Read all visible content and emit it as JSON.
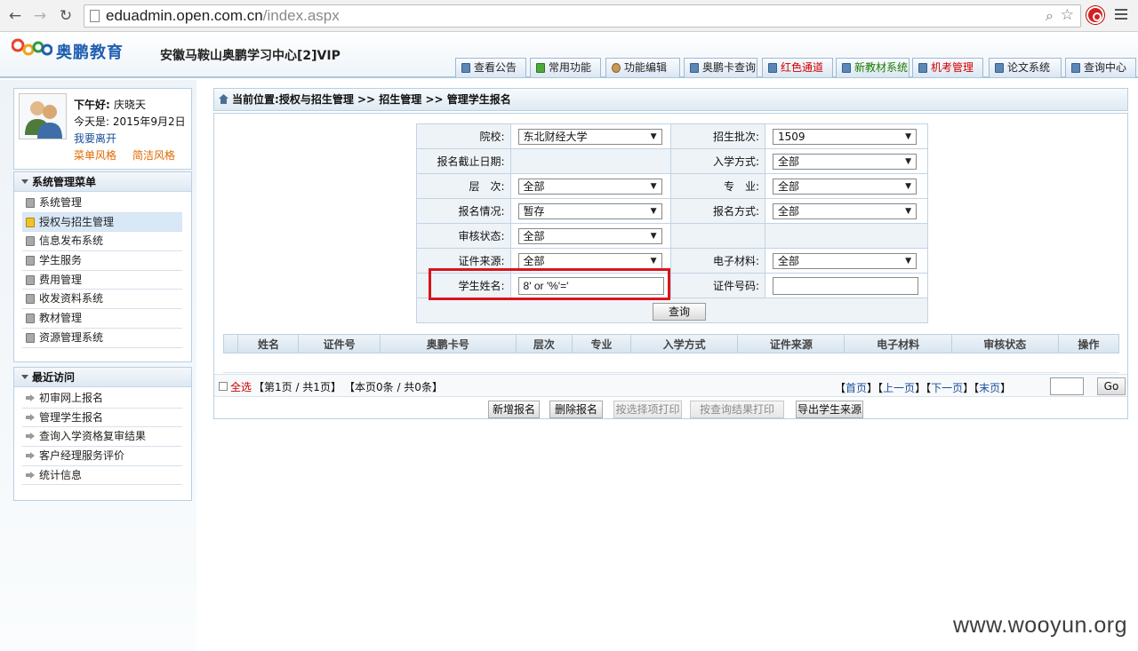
{
  "browser": {
    "url_host": "eduadmin.open.com.cn",
    "url_path": "/index.aspx"
  },
  "header": {
    "logo_text": "奥鹏教育",
    "center_name": "安徽马鞍山奥鹏学习中心[2]VIP",
    "nav": [
      "查看公告",
      "常用功能",
      "功能编辑",
      "奥鹏卡查询",
      "红色通道",
      "新教材系统",
      "机考管理",
      "论文系统",
      "查询中心"
    ]
  },
  "user": {
    "greeting": "下午好:",
    "name": "庆晓天",
    "today": "今天是: 2015年9月2日",
    "leave": "我要离开",
    "style_menu": "菜单风格",
    "style_simple": "简洁风格"
  },
  "system_menu": {
    "title": "系统管理菜单",
    "items": [
      "系统管理",
      "授权与招生管理",
      "信息发布系统",
      "学生服务",
      "费用管理",
      "收发资料系统",
      "教材管理",
      "资源管理系统"
    ]
  },
  "recent": {
    "title": "最近访问",
    "items": [
      "初审网上报名",
      "管理学生报名",
      "查询入学资格复审结果",
      "客户经理服务评价",
      "统计信息"
    ]
  },
  "breadcrumb": {
    "label": "当前位置:",
    "path": "授权与招生管理 >> 招生管理 >> 管理学生报名"
  },
  "form": {
    "school_label": "院校:",
    "school_value": "东北财经大学",
    "batch_label": "招生批次:",
    "batch_value": "1509",
    "deadline_label": "报名截止日期:",
    "entry_label": "入学方式:",
    "entry_value": "全部",
    "level_label": "层　次:",
    "level_value": "全部",
    "major_label": "专　业:",
    "major_value": "全部",
    "signup_label": "报名情况:",
    "signup_value": "暂存",
    "method_label": "报名方式:",
    "method_value": "全部",
    "audit_label": "审核状态:",
    "audit_value": "全部",
    "idsource_label": "证件来源:",
    "idsource_value": "全部",
    "emat_label": "电子材料:",
    "emat_value": "全部",
    "name_label": "学生姓名:",
    "name_value": "8' or '%'='",
    "idno_label": "证件号码:",
    "idno_value": "",
    "query_button": "查询"
  },
  "table": {
    "columns": [
      "姓名",
      "证件号",
      "奥鹏卡号",
      "层次",
      "专业",
      "入学方式",
      "证件来源",
      "电子材料",
      "审核状态",
      "操作"
    ]
  },
  "pager": {
    "select_all": "全选",
    "page_info": "【第1页 / 共1页】",
    "count_info": "【本页0条 / 共0条】",
    "first": "首页",
    "prev": "上一页",
    "next": "下一页",
    "last": "末页",
    "go": "Go"
  },
  "actions": {
    "add": "新增报名",
    "delete": "删除报名",
    "print_selected": "按选择项打印",
    "print_query": "按查询结果打印",
    "export": "导出学生来源"
  },
  "watermark": "www.wooyun.org"
}
